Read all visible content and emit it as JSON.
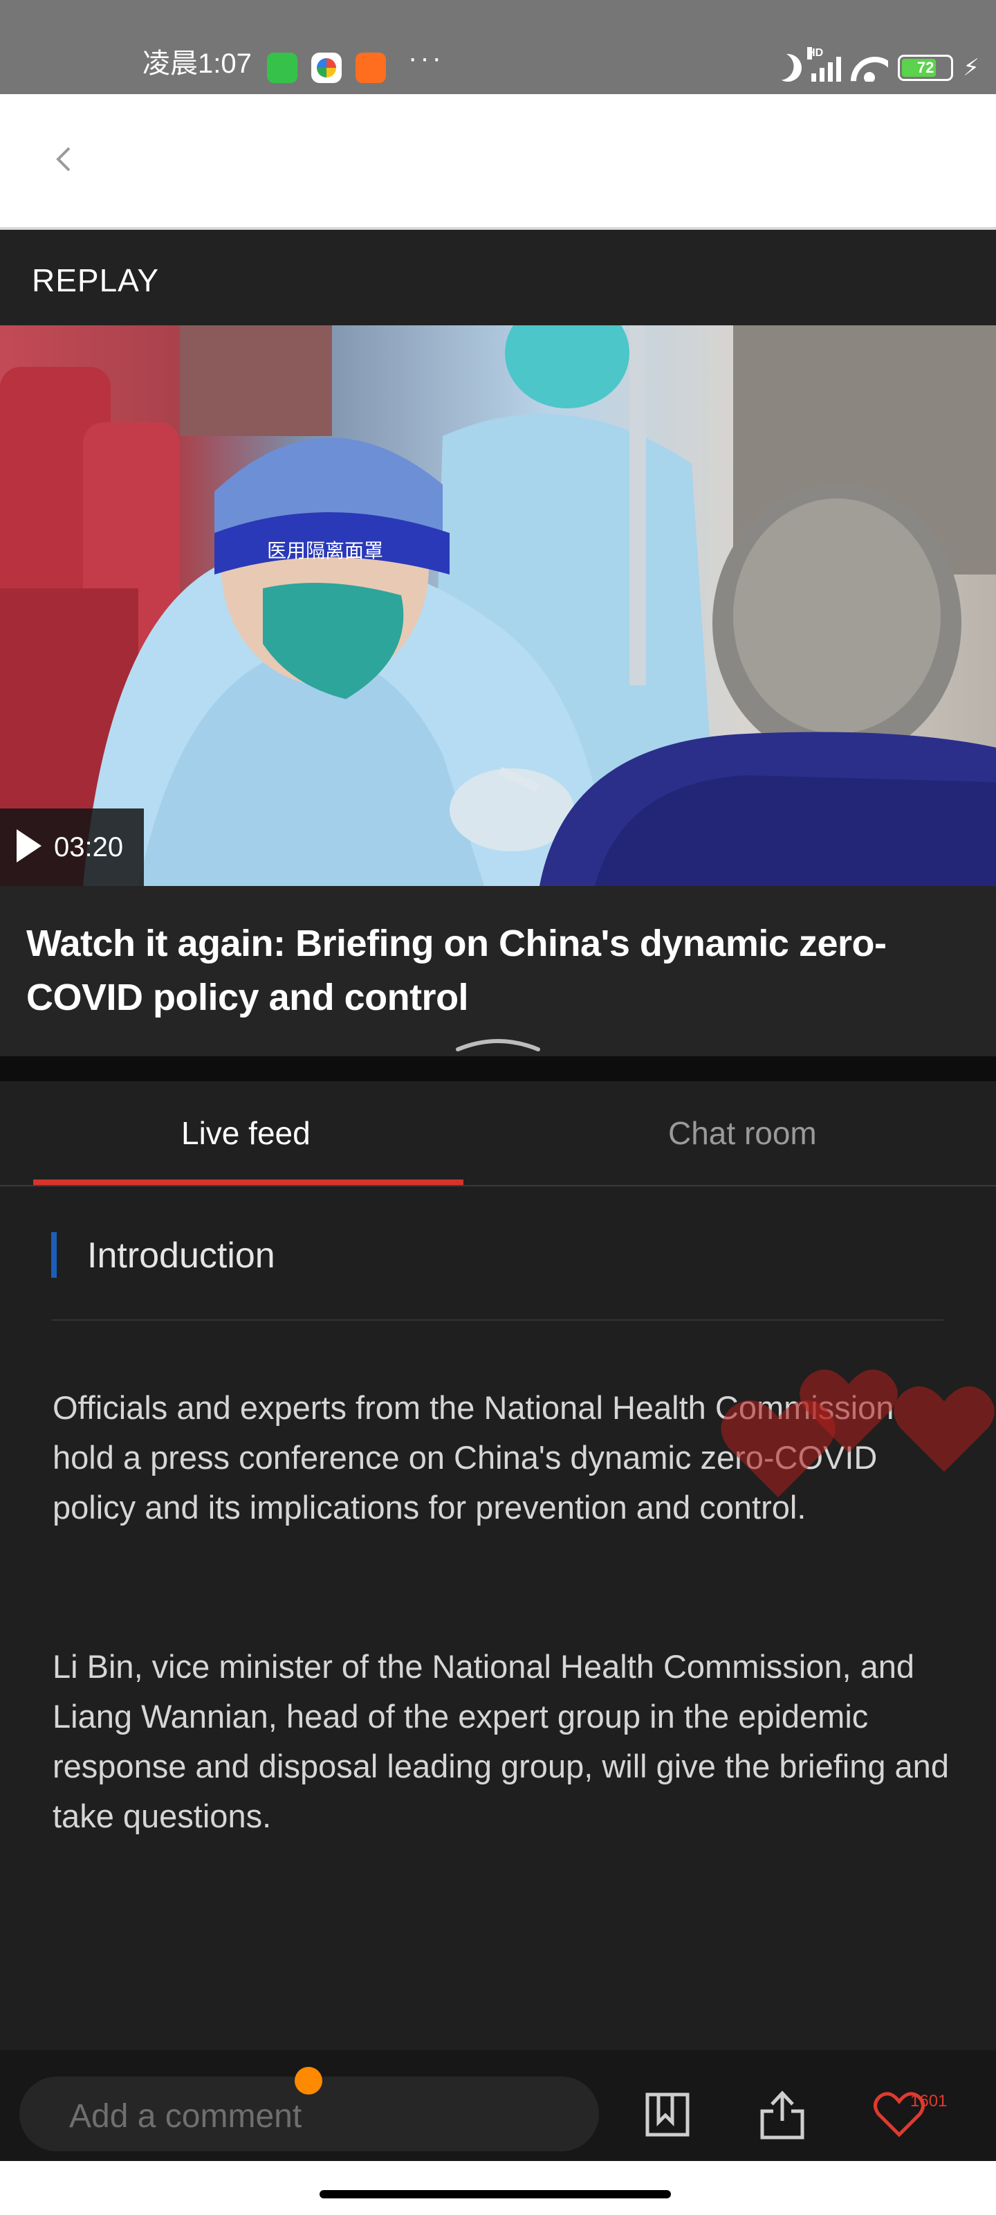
{
  "status_bar": {
    "time": "凌晨1:07",
    "more": "···",
    "signal_label": "HD",
    "battery": "72",
    "charging": "⚡"
  },
  "nav": {
    "back_icon": "chevron-left-icon"
  },
  "replay": {
    "label": "REPLAY"
  },
  "video": {
    "duration": "03:20",
    "title": "Watch it again: Briefing on China's dynamic zero-COVID policy and control",
    "image_text": "医用隔离面罩"
  },
  "tabs": [
    {
      "label": "Live feed",
      "active": true
    },
    {
      "label": "Chat room",
      "active": false
    }
  ],
  "intro": {
    "heading": "Introduction",
    "paragraphs": [
      "Officials and experts from the National Health Commission hold a press conference on China's dynamic zero-COVID policy and its implications for prevention and control.",
      "Li Bin, vice minister of the National Health Commission, and Liang Wannian, head of the expert group in the epidemic response and disposal leading group, will give the briefing and take questions."
    ]
  },
  "bottom_bar": {
    "comment_placeholder": "Add a comment",
    "like_count": "1601"
  },
  "colors": {
    "accent": "#d6342b",
    "intro_bar": "#1d5fb8",
    "notification": "#ff8a00",
    "background": "#1f1f1f"
  }
}
